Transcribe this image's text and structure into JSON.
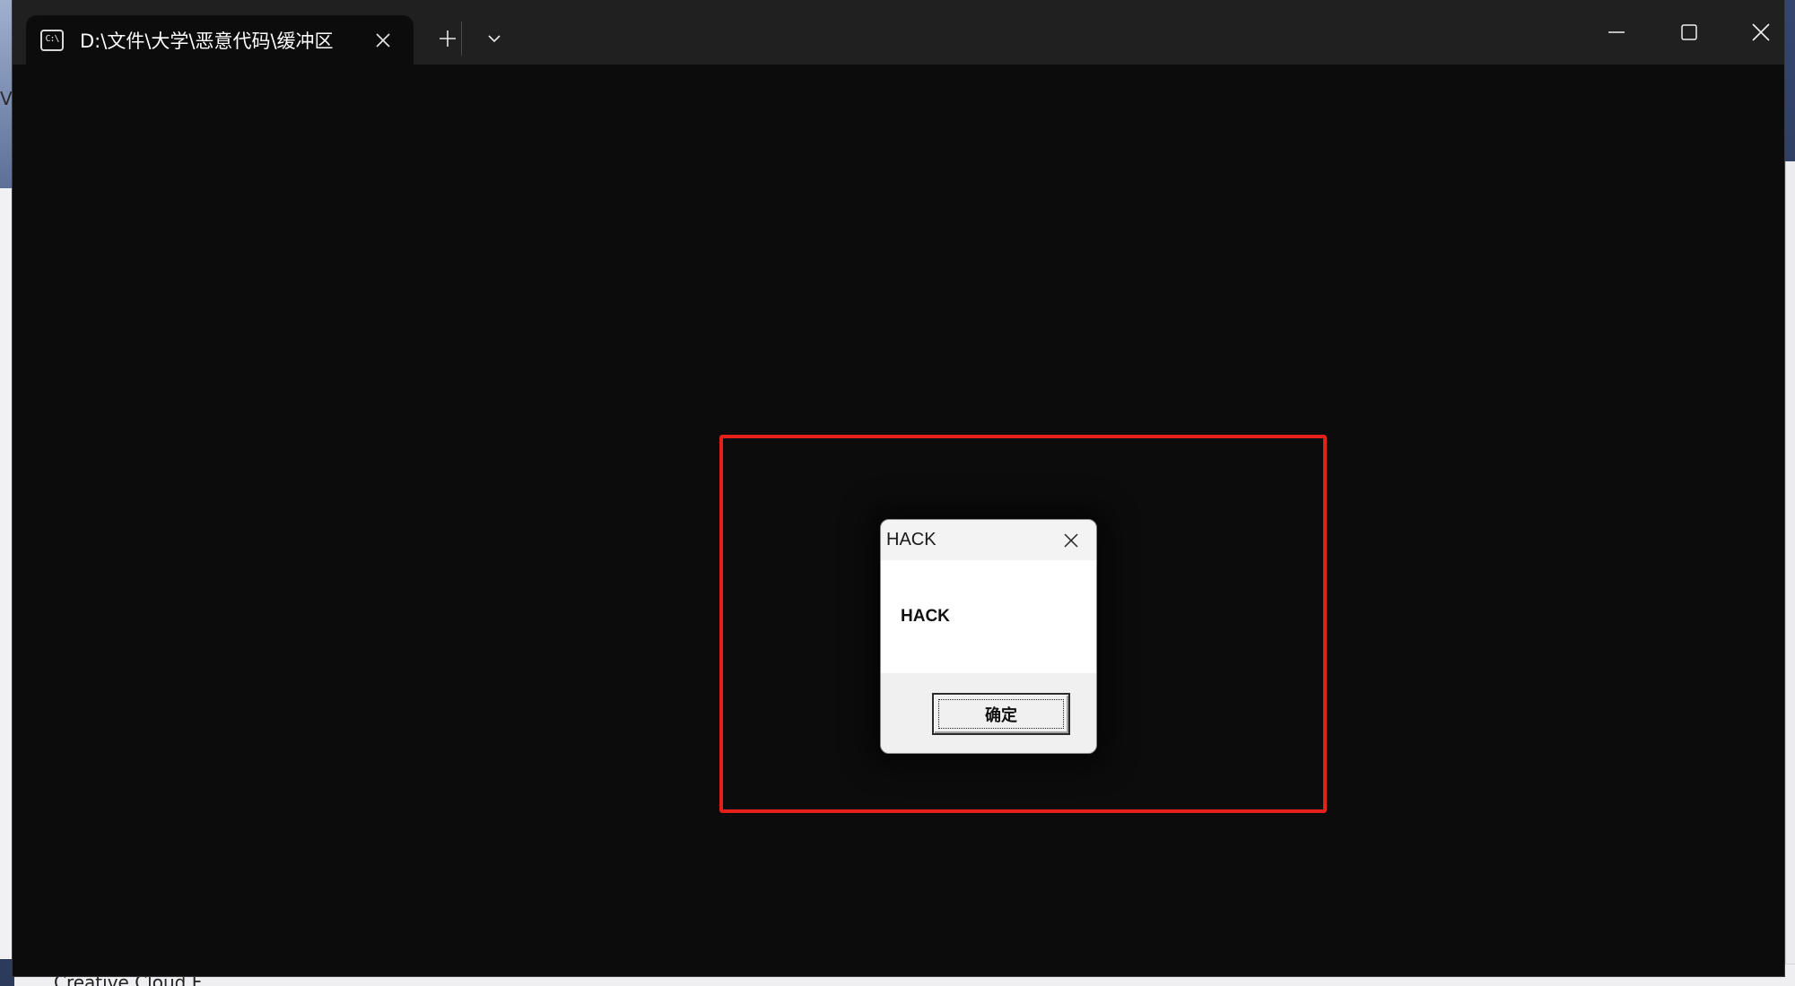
{
  "desktop": {
    "side_letter": "V",
    "bottom_label": "Creative Cloud F"
  },
  "terminal": {
    "tab": {
      "icon_text": "C:\\",
      "title": "D:\\文件\\大学\\恶意代码\\缓冲区"
    },
    "icons": {
      "tab_close": "close-icon",
      "new_tab": "plus-icon",
      "dropdown": "chevron-down-icon",
      "minimize": "minimize-icon",
      "maximize": "maximize-icon",
      "close": "close-icon"
    }
  },
  "highlight": {
    "color": "#e3201b"
  },
  "message_box": {
    "title": "HACK",
    "message": "HACK",
    "ok_label": "确定"
  }
}
